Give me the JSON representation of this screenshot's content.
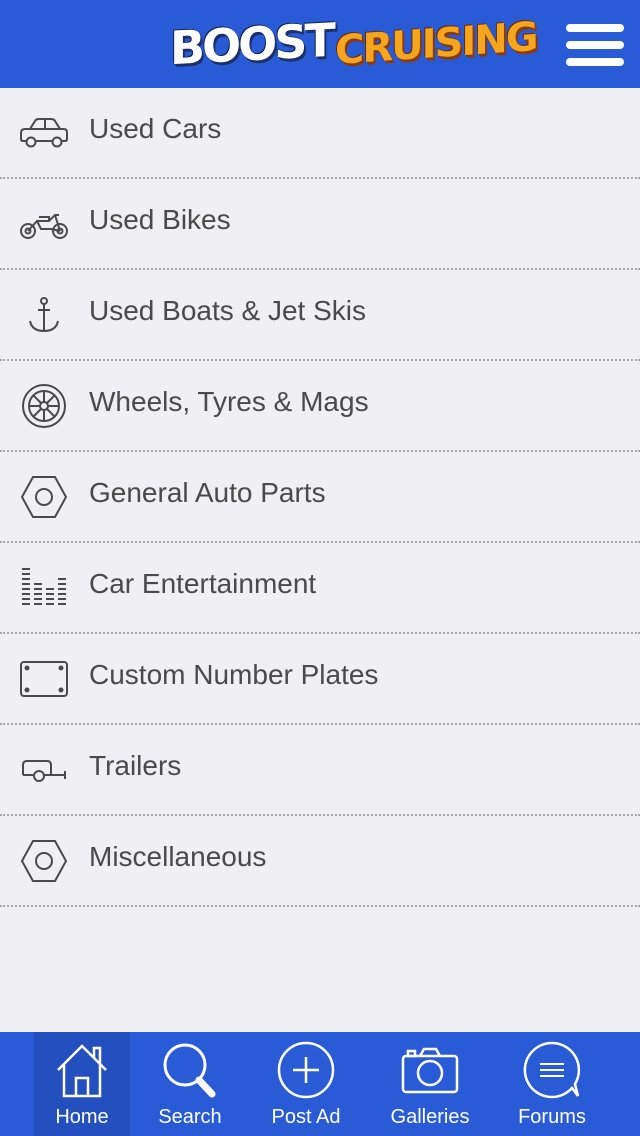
{
  "header": {
    "logo_part1": "BOOST",
    "logo_part2": "CRUISING",
    "menu_icon": "hamburger-menu-icon"
  },
  "categories": [
    {
      "label": "Used Cars",
      "icon": "car-icon"
    },
    {
      "label": "Used Bikes",
      "icon": "motorbike-icon"
    },
    {
      "label": "Used Boats & Jet Skis",
      "icon": "anchor-icon"
    },
    {
      "label": "Wheels, Tyres & Mags",
      "icon": "wheel-icon"
    },
    {
      "label": "General Auto Parts",
      "icon": "hex-nut-icon"
    },
    {
      "label": "Car Entertainment",
      "icon": "equalizer-icon"
    },
    {
      "label": "Custom Number Plates",
      "icon": "number-plate-icon"
    },
    {
      "label": "Trailers",
      "icon": "trailer-icon"
    },
    {
      "label": "Miscellaneous",
      "icon": "hex-nut-icon"
    }
  ],
  "tabs": [
    {
      "label": "Home",
      "icon": "home-icon",
      "active": true
    },
    {
      "label": "Search",
      "icon": "search-icon",
      "active": false
    },
    {
      "label": "Post Ad",
      "icon": "plus-circle-icon",
      "active": false
    },
    {
      "label": "Galleries",
      "icon": "camera-icon",
      "active": false
    },
    {
      "label": "Forums",
      "icon": "chat-bubble-icon",
      "active": false
    }
  ],
  "colors": {
    "brand_blue": "#2a5bd7",
    "background": "#efeff4",
    "text": "#4a4a4a",
    "logo_orange": "#f6a51e"
  }
}
